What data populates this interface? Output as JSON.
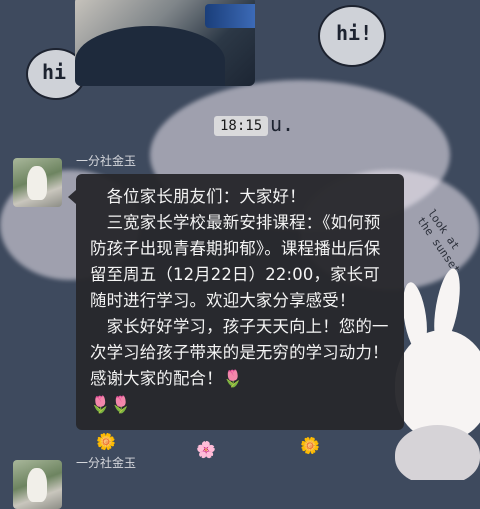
{
  "chat": {
    "timestamp": "18:15",
    "messages": [
      {
        "sender": "一分社金玉",
        "paragraphs": [
          "　各位家长朋友们：大家好！",
          "　三宽家长学校最新安排课程：《如何预防孩子出现青春期抑郁》。课程播出后保留至周五（12月22日）22:00，家长可随时进行学习。欢迎大家分享感受！",
          "　家长好好学习，孩子天天向上！您的一次学习给孩子带来的是无穷的学习动力！感谢大家的配合！"
        ],
        "emoji": "🌷",
        "emoji_count": 3
      },
      {
        "sender": "一分社金玉"
      }
    ]
  },
  "wallpaper": {
    "doodle_left": "hi",
    "doodle_right": "hi!",
    "doodle_mid": "u.",
    "sun_text": "look at the sunset",
    "accent_color": "#e0442f"
  }
}
